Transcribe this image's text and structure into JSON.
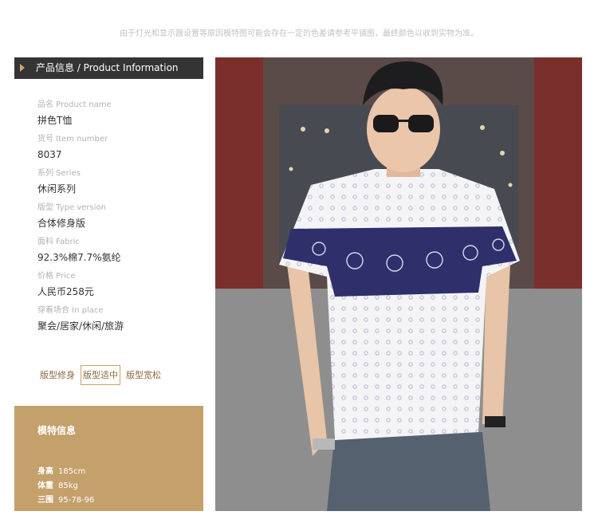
{
  "notice": "由于灯光和显示器设置等原因模特图可能会存在一定的色差请参考平铺图，最终颜色以收到实物为准。",
  "panel": {
    "header": "产品信息 / Product Information",
    "specs": [
      {
        "label": "品名  Product name",
        "value": "拼色T恤"
      },
      {
        "label": "货号  Item number",
        "value": "8037"
      },
      {
        "label": "系列  Series",
        "value": "休闲系列"
      },
      {
        "label": "版型  Type version",
        "value": "合体修身版"
      },
      {
        "label": "面料  Fabric",
        "value": "92.3%棉7.7%氨纶"
      },
      {
        "label": "价格  Price",
        "value": "人民币258元"
      },
      {
        "label": "穿着场合  In place",
        "value": "聚会/居家/休闲/旅游"
      }
    ],
    "fits": [
      {
        "label": "版型修身",
        "selected": false
      },
      {
        "label": "版型适中",
        "selected": true
      },
      {
        "label": "版型宽松",
        "selected": false
      }
    ]
  },
  "model": {
    "title": "模特信息",
    "height_label": "身高",
    "height_value": "185cm",
    "weight_label": "体重",
    "weight_value": "85kg",
    "measure_label": "三围",
    "measure_value": "95-78-96"
  },
  "colors": {
    "header_bg": "#343434",
    "accent": "#c4a06a",
    "print_navy": "#2e2f6b"
  }
}
